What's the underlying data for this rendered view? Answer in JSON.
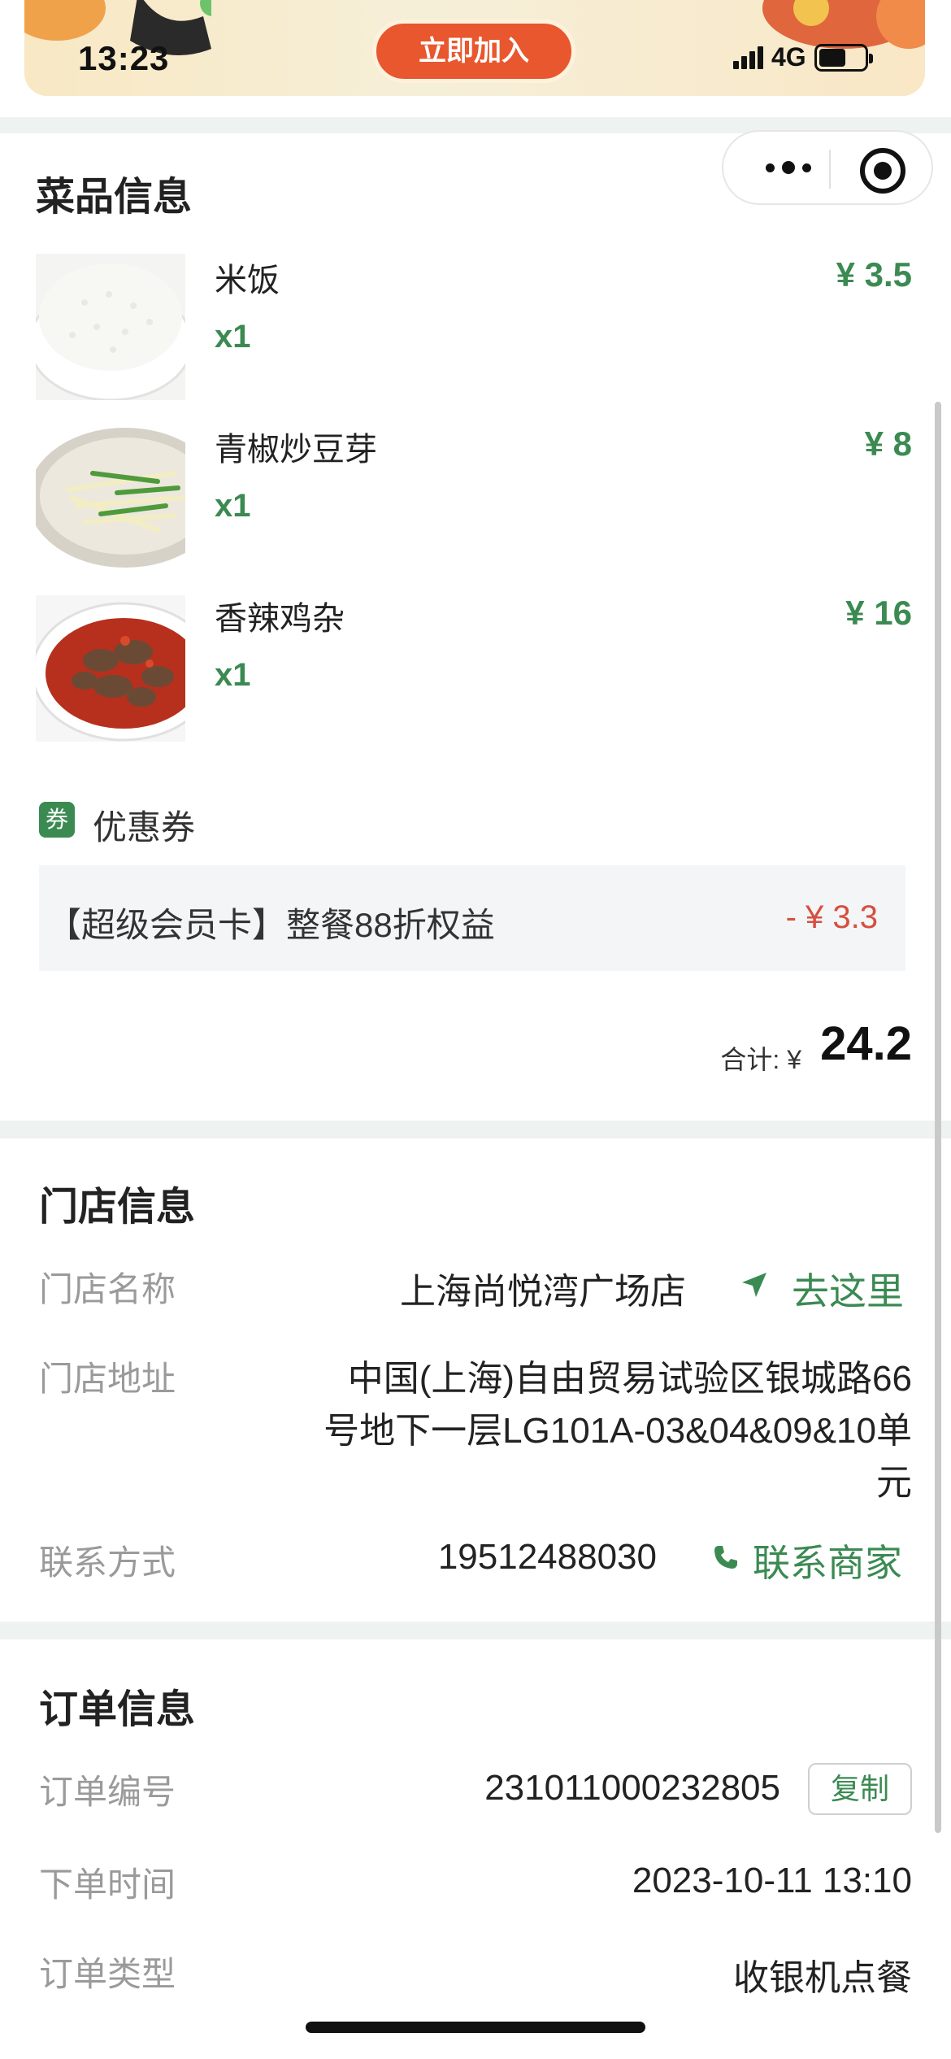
{
  "status_bar": {
    "time": "13:23",
    "network": "4G"
  },
  "banner": {
    "join_label": "立即加入"
  },
  "dishes_section": {
    "title": "菜品信息",
    "items": [
      {
        "name": "米饭",
        "qty": "x1",
        "price": "¥ 3.5",
        "image": "rice-bowl"
      },
      {
        "name": "青椒炒豆芽",
        "qty": "x1",
        "price": "¥ 8",
        "image": "bean-sprouts-plate"
      },
      {
        "name": "香辣鸡杂",
        "qty": "x1",
        "price": "¥ 16",
        "image": "spicy-chicken-bowl"
      }
    ],
    "coupon": {
      "badge": "券",
      "label": "优惠券",
      "name": "【超级会员卡】整餐88折权益",
      "amount": "- ¥ 3.3"
    },
    "total": {
      "label": "合计: ¥",
      "value": "24.2"
    }
  },
  "store_section": {
    "title": "门店信息",
    "name_label": "门店名称",
    "name_value": "上海尚悦湾广场店",
    "navigate_label": "去这里",
    "address_label": "门店地址",
    "address_lines": [
      "中国(上海)自由贸易试验区银城路66",
      "号地下一层LG101A-03&04&09&10单",
      "元"
    ],
    "contact_label": "联系方式",
    "contact_value": "19512488030",
    "contact_action": "联系商家"
  },
  "order_section": {
    "title": "订单信息",
    "number_label": "订单编号",
    "number_value": "231011000232805",
    "copy_label": "复制",
    "time_label": "下单时间",
    "time_value": "2023-10-11 13:10",
    "type_label": "订单类型",
    "type_value": "收银机点餐"
  },
  "colors": {
    "accent_green": "#3b8a52",
    "discount_red": "#d64f3f",
    "section_bg": "#eef2f0"
  },
  "icons": [
    "more-dots-icon",
    "target-icon",
    "navigate-arrow-icon",
    "phone-icon"
  ]
}
